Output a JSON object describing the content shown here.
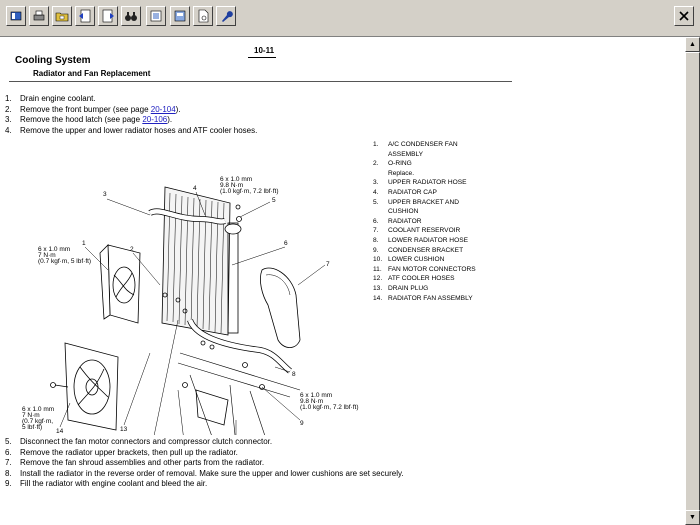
{
  "toolbar": {
    "buttons": [
      "book-icon",
      "print-icon",
      "folder-icon",
      "back-icon",
      "forward-icon",
      "binoculars-icon",
      "notepad-icon",
      "bookmark-icon",
      "page-icon",
      "wrench-icon"
    ],
    "close_icon": "close-icon"
  },
  "page": {
    "number": "10-11",
    "title": "Cooling System",
    "subtitle": "Radiator and Fan Replacement"
  },
  "steps_top": [
    {
      "n": "1.",
      "text": "Drain engine coolant."
    },
    {
      "n": "2.",
      "text": "Remove the front bumper (see page ",
      "link": "20-104",
      "after": ")."
    },
    {
      "n": "3.",
      "text": "Remove the hood latch (see page ",
      "link": "20-106",
      "after": ")."
    },
    {
      "n": "4.",
      "text": "Remove the upper and lower radiator hoses and ATF cooler hoses."
    }
  ],
  "legend": [
    {
      "n": "1.",
      "lines": [
        "A/C CONDENSER FAN",
        "ASSEMBLY"
      ]
    },
    {
      "n": "2.",
      "lines": [
        "O-RING",
        "Replace."
      ]
    },
    {
      "n": "3.",
      "lines": [
        "UPPER RADIATOR HOSE"
      ]
    },
    {
      "n": "4.",
      "lines": [
        "RADIATOR CAP"
      ]
    },
    {
      "n": "5.",
      "lines": [
        "UPPER BRACKET AND",
        "CUSHION"
      ]
    },
    {
      "n": "6.",
      "lines": [
        "RADIATOR"
      ]
    },
    {
      "n": "7.",
      "lines": [
        "COOLANT RESERVOIR"
      ]
    },
    {
      "n": "8.",
      "lines": [
        "LOWER RADIATOR HOSE"
      ]
    },
    {
      "n": "9.",
      "lines": [
        "CONDENSER BRACKET"
      ]
    },
    {
      "n": "10.",
      "lines": [
        "LOWER CUSHION"
      ]
    },
    {
      "n": "11.",
      "lines": [
        "FAN MOTOR CONNECTORS"
      ]
    },
    {
      "n": "12.",
      "lines": [
        "ATF COOLER HOSES"
      ]
    },
    {
      "n": "13.",
      "lines": [
        "DRAIN PLUG"
      ]
    },
    {
      "n": "14.",
      "lines": [
        "RADIATOR FAN ASSEMBLY"
      ]
    }
  ],
  "diagram": {
    "torque_top": [
      "6 x 1.0 mm",
      "9.8 N·m",
      "(1.0 kgf·m, 7.2 lbf·ft)"
    ],
    "torque_left": [
      "6 x 1.0 mm",
      "7 N·m",
      "(0.7 kgf·m, 5 lbf·ft)"
    ],
    "torque_right": [
      "6 x 1.0 mm",
      "9.8 N·m",
      "(1.0 kgf·m, 7.2 lbf·ft)"
    ],
    "torque_bottom_left": [
      "6 x 1.0 mm",
      "7 N·m",
      "(0.7 kgf·m,",
      "5 lbf·ft)"
    ],
    "callouts": [
      "1",
      "2",
      "3",
      "4",
      "5",
      "6",
      "7",
      "8",
      "9",
      "10",
      "11",
      "12",
      "13",
      "14"
    ]
  },
  "steps_bottom": [
    {
      "n": "5.",
      "text": "Disconnect the fan motor connectors and compressor clutch connector."
    },
    {
      "n": "6.",
      "text": "Remove the radiator upper brackets, then pull up the radiator."
    },
    {
      "n": "7.",
      "text": "Remove the fan shroud assemblies and other parts from the radiator."
    },
    {
      "n": "8.",
      "text": "Install the radiator in the reverse order of removal. Make sure the upper and lower cushions are set securely."
    },
    {
      "n": "9.",
      "text": "Fill the radiator with engine coolant and bleed the air."
    }
  ]
}
